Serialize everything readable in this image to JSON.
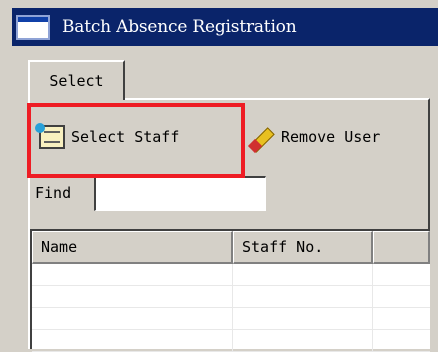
{
  "window": {
    "title": "Batch Absence Registration"
  },
  "tabs": [
    {
      "label": "Select"
    }
  ],
  "toolbar": {
    "select_staff_label": "Select Staff",
    "remove_user_label": "Remove User",
    "select_staff_icon": "staff-card-icon",
    "remove_user_icon": "eraser-icon"
  },
  "find": {
    "label": "Find",
    "value": "",
    "placeholder": ""
  },
  "grid": {
    "columns": [
      "Name",
      "Staff No.",
      ""
    ],
    "rows": [
      [
        "",
        "",
        ""
      ],
      [
        "",
        "",
        ""
      ],
      [
        "",
        "",
        ""
      ],
      [
        "",
        "",
        ""
      ]
    ]
  },
  "colors": {
    "titlebar": "#0a246a",
    "face": "#d4d0c8",
    "highlight": "#ee1c24"
  }
}
